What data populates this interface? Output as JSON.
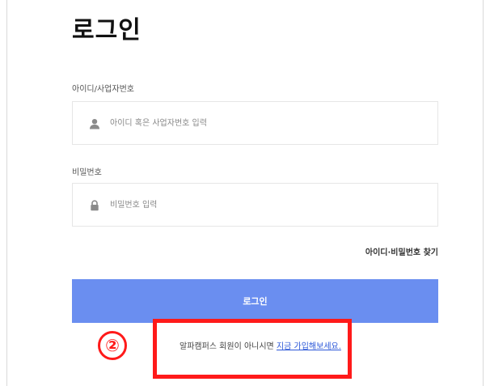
{
  "login": {
    "title": "로그인",
    "id_label": "아이디/사업자번호",
    "id_placeholder": "아이디 혹은 사업자번호 입력",
    "password_label": "비밀번호",
    "password_placeholder": "비밀번호 입력",
    "find_link": "아이디·비밀번호 찾기",
    "submit_label": "로그인",
    "signup_prompt": "알파캠퍼스 회원이 아니시면",
    "signup_link": "지금 가입해보세요.",
    "button_color": "#6a8ef0"
  },
  "annotation": {
    "step_number": "2",
    "step_badge_text": "②",
    "highlight_color": "#ff1a1a"
  },
  "icons": {
    "id_field": "user-icon",
    "password_field": "lock-icon"
  }
}
